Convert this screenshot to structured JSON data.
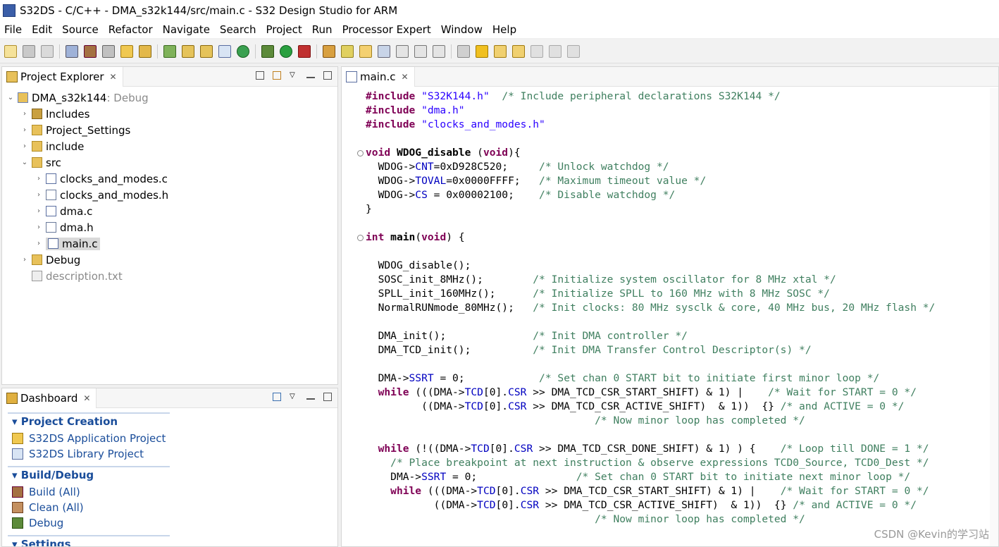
{
  "window": {
    "title": "S32DS - C/C++ - DMA_s32k144/src/main.c - S32 Design Studio for ARM"
  },
  "menu": [
    "File",
    "Edit",
    "Source",
    "Refactor",
    "Navigate",
    "Search",
    "Project",
    "Run",
    "Processor Expert",
    "Window",
    "Help"
  ],
  "explorer": {
    "tab_label": "Project Explorer",
    "project_name": "DMA_s32k144",
    "project_suffix": ": Debug",
    "items": [
      {
        "label": "Includes"
      },
      {
        "label": "Project_Settings"
      },
      {
        "label": "include"
      },
      {
        "label": "src"
      },
      {
        "label": "clocks_and_modes.c"
      },
      {
        "label": "clocks_and_modes.h"
      },
      {
        "label": "dma.c"
      },
      {
        "label": "dma.h"
      },
      {
        "label": "main.c"
      },
      {
        "label": "Debug"
      },
      {
        "label": "description.txt"
      }
    ]
  },
  "dashboard": {
    "tab_label": "Dashboard",
    "project_creation": "Project Creation",
    "app_project": "S32DS Application Project",
    "lib_project": "S32DS Library Project",
    "build_debug": "Build/Debug",
    "build": "Build  (All)",
    "clean": "Clean  (All)",
    "debug": "Debug",
    "settings": "Settings"
  },
  "editor": {
    "tab_label": "main.c",
    "lines": [
      {
        "i": "",
        "s": [
          {
            "t": "#include ",
            "c": "kw"
          },
          {
            "t": "\"S32K144.h\"",
            "c": "str"
          },
          {
            "t": "  "
          },
          {
            "t": "/* Include peripheral declarations S32K144 */",
            "c": "cm"
          }
        ]
      },
      {
        "i": "",
        "s": [
          {
            "t": "#include ",
            "c": "kw"
          },
          {
            "t": "\"dma.h\"",
            "c": "str"
          }
        ]
      },
      {
        "i": "",
        "s": [
          {
            "t": "#include ",
            "c": "kw"
          },
          {
            "t": "\"clocks_and_modes.h\"",
            "c": "str"
          }
        ]
      },
      {
        "i": "",
        "s": []
      },
      {
        "i": "",
        "fold": true,
        "s": [
          {
            "t": "void ",
            "c": "kw"
          },
          {
            "t": "WDOG_disable",
            "c": "bold"
          },
          {
            "t": " ("
          },
          {
            "t": "void",
            "c": "kw"
          },
          {
            "t": "){"
          }
        ]
      },
      {
        "i": "  ",
        "s": [
          {
            "t": "WDOG->"
          },
          {
            "t": "CNT",
            "c": "fld"
          },
          {
            "t": "=0xD928C520;     "
          },
          {
            "t": "/* Unlock watchdog */",
            "c": "cm"
          }
        ]
      },
      {
        "i": "  ",
        "s": [
          {
            "t": "WDOG->"
          },
          {
            "t": "TOVAL",
            "c": "fld"
          },
          {
            "t": "=0x0000FFFF;   "
          },
          {
            "t": "/* Maximum timeout value */",
            "c": "cm"
          }
        ]
      },
      {
        "i": "  ",
        "s": [
          {
            "t": "WDOG->"
          },
          {
            "t": "CS",
            "c": "fld"
          },
          {
            "t": " = 0x00002100;    "
          },
          {
            "t": "/* Disable watchdog */",
            "c": "cm"
          }
        ]
      },
      {
        "i": "",
        "s": [
          {
            "t": "}"
          }
        ]
      },
      {
        "i": "",
        "s": []
      },
      {
        "i": "",
        "fold": true,
        "s": [
          {
            "t": "int ",
            "c": "kw"
          },
          {
            "t": "main",
            "c": "bold"
          },
          {
            "t": "("
          },
          {
            "t": "void",
            "c": "kw"
          },
          {
            "t": ") {"
          }
        ]
      },
      {
        "i": "",
        "s": []
      },
      {
        "i": "  ",
        "s": [
          {
            "t": "WDOG_disable();"
          }
        ]
      },
      {
        "i": "  ",
        "s": [
          {
            "t": "SOSC_init_8MHz();        "
          },
          {
            "t": "/* Initialize system oscillator for 8 MHz xtal */",
            "c": "cm"
          }
        ]
      },
      {
        "i": "  ",
        "s": [
          {
            "t": "SPLL_init_160MHz();      "
          },
          {
            "t": "/* Initialize SPLL to 160 MHz with 8 MHz SOSC */",
            "c": "cm"
          }
        ]
      },
      {
        "i": "  ",
        "s": [
          {
            "t": "NormalRUNmode_80MHz();   "
          },
          {
            "t": "/* Init clocks: 80 MHz sysclk & core, 40 MHz bus, 20 MHz flash */",
            "c": "cm"
          }
        ]
      },
      {
        "i": "",
        "s": []
      },
      {
        "i": "  ",
        "s": [
          {
            "t": "DMA_init();              "
          },
          {
            "t": "/* Init DMA controller */",
            "c": "cm"
          }
        ]
      },
      {
        "i": "  ",
        "s": [
          {
            "t": "DMA_TCD_init();          "
          },
          {
            "t": "/* Init DMA Transfer Control Descriptor(s) */",
            "c": "cm"
          }
        ]
      },
      {
        "i": "",
        "s": []
      },
      {
        "i": "  ",
        "s": [
          {
            "t": "DMA->"
          },
          {
            "t": "SSRT",
            "c": "fld"
          },
          {
            "t": " = 0;            "
          },
          {
            "t": "/* Set chan 0 START bit to initiate first minor loop */",
            "c": "cm"
          }
        ]
      },
      {
        "i": "  ",
        "s": [
          {
            "t": "while ",
            "c": "kw"
          },
          {
            "t": "(((DMA->"
          },
          {
            "t": "TCD",
            "c": "fld"
          },
          {
            "t": "[0]."
          },
          {
            "t": "CSR",
            "c": "fld"
          },
          {
            "t": " >> DMA_TCD_CSR_START_SHIFT) & 1) |    "
          },
          {
            "t": "/* Wait for START = 0 */",
            "c": "cm"
          }
        ]
      },
      {
        "i": "         ",
        "s": [
          {
            "t": "((DMA->"
          },
          {
            "t": "TCD",
            "c": "fld"
          },
          {
            "t": "[0]."
          },
          {
            "t": "CSR",
            "c": "fld"
          },
          {
            "t": " >> DMA_TCD_CSR_ACTIVE_SHIFT)  & 1))  {} "
          },
          {
            "t": "/* and ACTIVE = 0 */",
            "c": "cm"
          }
        ]
      },
      {
        "i": "                                     ",
        "s": [
          {
            "t": "/* Now minor loop has completed */",
            "c": "cm"
          }
        ]
      },
      {
        "i": "",
        "s": []
      },
      {
        "i": "  ",
        "s": [
          {
            "t": "while ",
            "c": "kw"
          },
          {
            "t": "(!((DMA->"
          },
          {
            "t": "TCD",
            "c": "fld"
          },
          {
            "t": "[0]."
          },
          {
            "t": "CSR",
            "c": "fld"
          },
          {
            "t": " >> DMA_TCD_CSR_DONE_SHIFT) & 1) ) {    "
          },
          {
            "t": "/* Loop till DONE = 1 */",
            "c": "cm"
          }
        ]
      },
      {
        "i": "    ",
        "s": [
          {
            "t": "/* Place breakpoint at next instruction & observe expressions TCD0_Source, TCD0_Dest */",
            "c": "cm"
          }
        ]
      },
      {
        "i": "    ",
        "s": [
          {
            "t": "DMA->"
          },
          {
            "t": "SSRT",
            "c": "fld"
          },
          {
            "t": " = 0;                "
          },
          {
            "t": "/* Set chan 0 START bit to initiate next minor loop */",
            "c": "cm"
          }
        ]
      },
      {
        "i": "    ",
        "s": [
          {
            "t": "while ",
            "c": "kw"
          },
          {
            "t": "(((DMA->"
          },
          {
            "t": "TCD",
            "c": "fld"
          },
          {
            "t": "[0]."
          },
          {
            "t": "CSR",
            "c": "fld"
          },
          {
            "t": " >> DMA_TCD_CSR_START_SHIFT) & 1) |    "
          },
          {
            "t": "/* Wait for START = 0 */",
            "c": "cm"
          }
        ]
      },
      {
        "i": "           ",
        "s": [
          {
            "t": "((DMA->"
          },
          {
            "t": "TCD",
            "c": "fld"
          },
          {
            "t": "[0]."
          },
          {
            "t": "CSR",
            "c": "fld"
          },
          {
            "t": " >> DMA_TCD_CSR_ACTIVE_SHIFT)  & 1))  {} "
          },
          {
            "t": "/* and ACTIVE = 0 */",
            "c": "cm"
          }
        ]
      },
      {
        "i": "                                     ",
        "s": [
          {
            "t": "/* Now minor loop has completed */",
            "c": "cm"
          }
        ]
      }
    ]
  },
  "watermark": "CSDN @Kevin的学习站",
  "colors": {
    "keyword": "#7f0055",
    "string": "#2a00ff",
    "comment": "#3f7f5f",
    "field": "#0000c0",
    "link": "#1a4d9a"
  }
}
